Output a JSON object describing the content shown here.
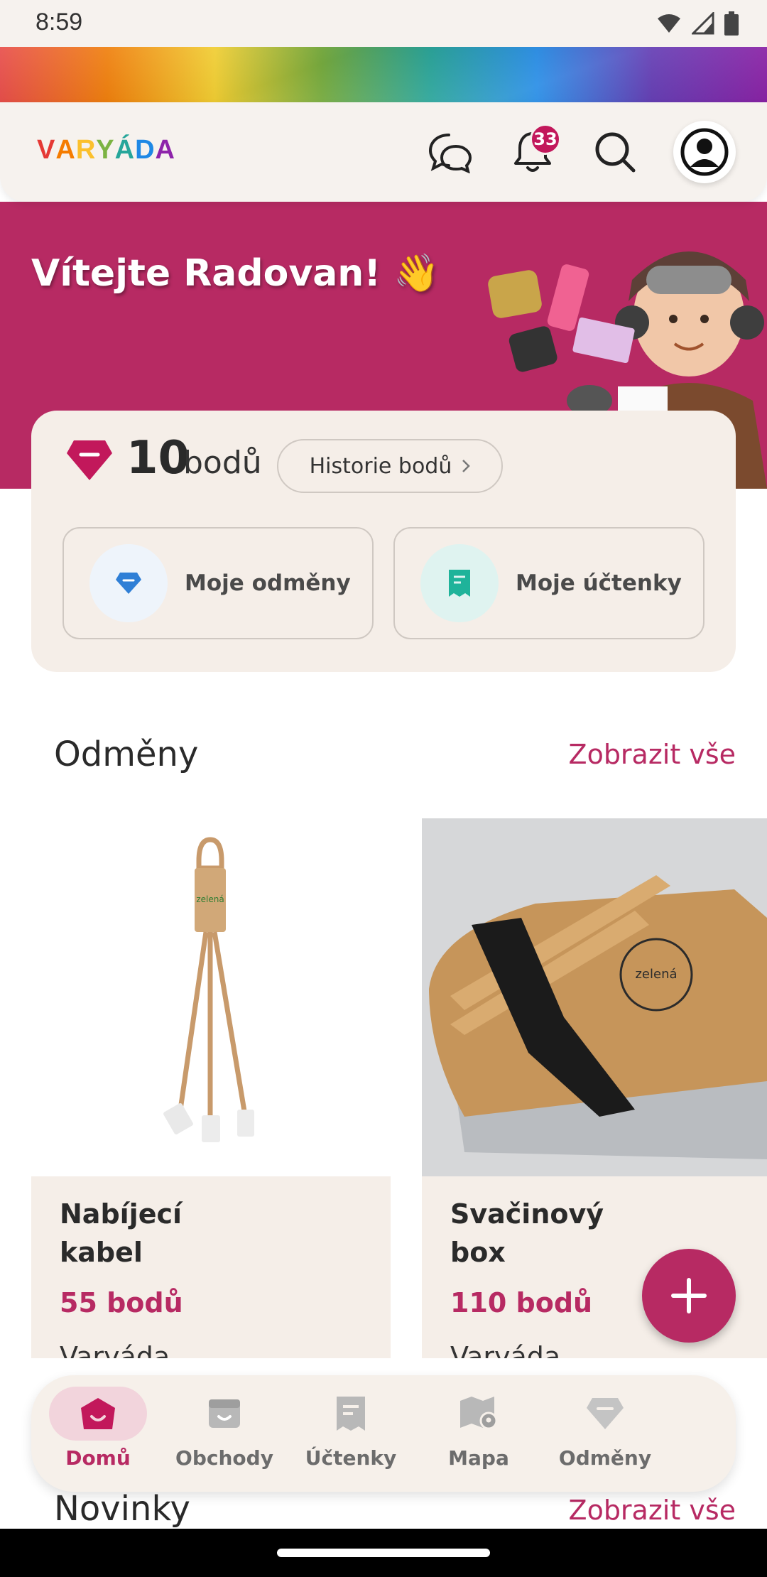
{
  "status_bar": {
    "time": "8:59"
  },
  "header": {
    "logo_text": "VARYÁDA",
    "notification_count": "33",
    "icons": [
      "chat-icon",
      "bell-icon",
      "search-icon",
      "account-icon"
    ]
  },
  "hero": {
    "greeting": "Vítejte Radovan! 👋"
  },
  "points": {
    "value": "10",
    "unit": "bodů",
    "history_label": "Historie bodů",
    "my_rewards_label": "Moje odměny",
    "my_receipts_label": "Moje účtenky"
  },
  "rewards_section": {
    "title": "Odměny",
    "view_all": "Zobrazit vše",
    "items": [
      {
        "name": "Nabíjecí kabel",
        "price": "55 bodů",
        "shop": "Varyáda"
      },
      {
        "name": "Svačinový box",
        "price": "110 bodů",
        "shop": "Varyáda"
      }
    ]
  },
  "news_section": {
    "title": "Novinky",
    "view_all": "Zobrazit vše"
  },
  "bottom_nav": {
    "items": [
      {
        "label": "Domů",
        "icon": "home-icon",
        "active": true
      },
      {
        "label": "Obchody",
        "icon": "store-icon",
        "active": false
      },
      {
        "label": "Účtenky",
        "icon": "receipt-icon",
        "active": false
      },
      {
        "label": "Mapa",
        "icon": "map-icon",
        "active": false
      },
      {
        "label": "Odměny",
        "icon": "diamond-icon",
        "active": false
      }
    ]
  },
  "colors": {
    "brand": "#b72a63",
    "card_bg": "#f5eee8",
    "header_bg": "#f6f2ee"
  }
}
